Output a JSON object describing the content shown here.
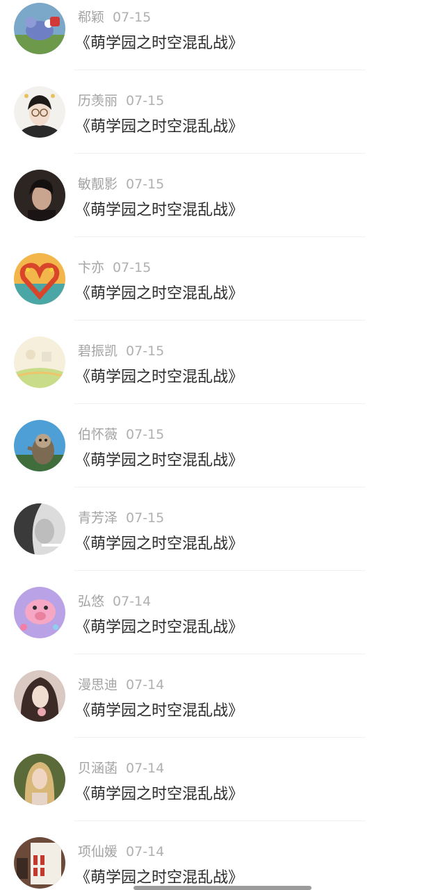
{
  "items": [
    {
      "name": "郗颖",
      "date": "07-15",
      "title": "《萌学园之时空混乱战》",
      "avatar": "cartoon-mouse-avatar"
    },
    {
      "name": "历羡丽",
      "date": "07-15",
      "title": "《萌学园之时空混乱战》",
      "avatar": "girl-glasses-avatar"
    },
    {
      "name": "敏靓影",
      "date": "07-15",
      "title": "《萌学园之时空混乱战》",
      "avatar": "dark-portrait-avatar"
    },
    {
      "name": "卞亦",
      "date": "07-15",
      "title": "《萌学园之时空混乱战》",
      "avatar": "flower-heart-avatar"
    },
    {
      "name": "碧振凯",
      "date": "07-15",
      "title": "《萌学园之时空混乱战》",
      "avatar": "pastel-landscape-avatar"
    },
    {
      "name": "伯怀薇",
      "date": "07-15",
      "title": "《萌学园之时空混乱战》",
      "avatar": "sloth-cartoon-avatar"
    },
    {
      "name": "青芳泽",
      "date": "07-15",
      "title": "《萌学园之时空混乱战》",
      "avatar": "bw-portrait-avatar"
    },
    {
      "name": "弘悠",
      "date": "07-14",
      "title": "《萌学园之时空混乱战》",
      "avatar": "pink-pig-avatar"
    },
    {
      "name": "漫思迪",
      "date": "07-14",
      "title": "《萌学园之时空混乱战》",
      "avatar": "anime-girl-avatar"
    },
    {
      "name": "贝涵菡",
      "date": "07-14",
      "title": "《萌学园之时空混乱战》",
      "avatar": "blonde-girl-avatar"
    },
    {
      "name": "项仙媛",
      "date": "07-14",
      "title": "《萌学园之时空混乱战》",
      "avatar": "poster-avatar"
    }
  ],
  "colors": {
    "name_text": "#a3a3a3",
    "title_text": "#2b2b2b",
    "divider": "#f0f0f0",
    "home_indicator": "#9b9b9b"
  }
}
